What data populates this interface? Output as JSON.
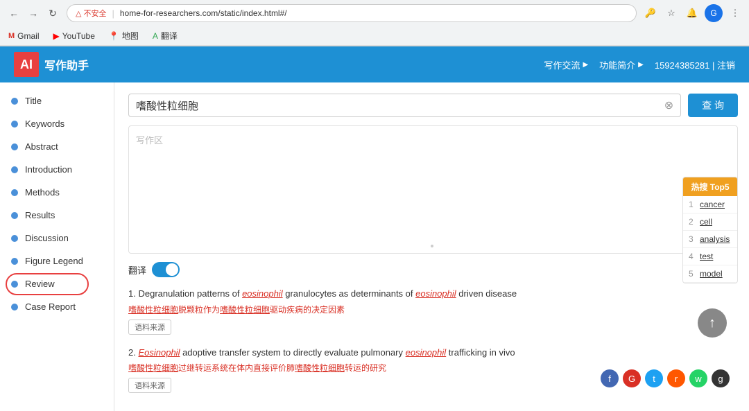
{
  "browser": {
    "security_warning": "不安全",
    "address": "home-for-researchers.com/static/index.html#/",
    "bookmarks": [
      {
        "label": "Gmail",
        "type": "gmail"
      },
      {
        "label": "YouTube",
        "type": "youtube"
      },
      {
        "label": "地图",
        "type": "maps"
      },
      {
        "label": "翻译",
        "type": "translate"
      }
    ]
  },
  "header": {
    "logo_text": "写作助手",
    "logo_icon": "AI",
    "nav_items": [
      "写作交流",
      "功能简介",
      "15924385281 | 注销"
    ]
  },
  "sidebar": {
    "items": [
      {
        "label": "Title",
        "active": false
      },
      {
        "label": "Keywords",
        "active": false
      },
      {
        "label": "Abstract",
        "active": false
      },
      {
        "label": "Introduction",
        "active": false
      },
      {
        "label": "Methods",
        "active": false
      },
      {
        "label": "Results",
        "active": false
      },
      {
        "label": "Discussion",
        "active": false
      },
      {
        "label": "Figure Legend",
        "active": false
      },
      {
        "label": "Review",
        "active": true,
        "highlighted": true
      },
      {
        "label": "Case Report",
        "active": false
      }
    ]
  },
  "search": {
    "query": "嗜酸性粒细胞",
    "placeholder": "写作区",
    "button_label": "查 询",
    "clear_title": "×"
  },
  "translate": {
    "label": "翻译",
    "enabled": true
  },
  "hot_panel": {
    "title": "热搜 Top5",
    "items": [
      {
        "rank": "1",
        "term": "cancer"
      },
      {
        "rank": "2",
        "term": "cell"
      },
      {
        "rank": "3",
        "term": "analysis"
      },
      {
        "rank": "4",
        "term": "test"
      },
      {
        "rank": "5",
        "term": "model"
      }
    ]
  },
  "results": [
    {
      "number": "1.",
      "title_parts": [
        {
          "text": "Degranulation patterns of "
        },
        {
          "text": "eosinophil",
          "highlight": true
        },
        {
          "text": " granulocytes as determinants of "
        },
        {
          "text": "eosinophil",
          "highlight": true
        },
        {
          "text": " driven disease"
        }
      ],
      "title_display": "Degranulation patterns of eosinophil granulocytes as determinants of eosinophil driven disease",
      "translation": "嗜酸性粒细胞脱颗粒作为嗜酸性粒细胞驱动疾病的决定因素",
      "translation_underline1": "嗜酸性粒细胞",
      "translation_underline2": "嗜酸性粒细胞",
      "source_label": "语料来源"
    },
    {
      "number": "2.",
      "title_parts": [
        {
          "text": "Eosinophil",
          "highlight": true
        },
        {
          "text": " adoptive transfer system to directly evaluate pulmonary "
        },
        {
          "text": "eosinophil",
          "highlight": true
        },
        {
          "text": " trafficking in vivo"
        }
      ],
      "title_display": "Eosinophil adoptive transfer system to directly evaluate pulmonary eosinophil trafficking in vivo",
      "translation": "嗜酸性粒细胞过继转运系统在体内直接评价肺嗜酸性粒细胞转运的研究",
      "translation_underline1": "嗜酸性粒细胞",
      "translation_underline2": "嗜酸性粒细胞",
      "source_label": "语料来源"
    }
  ],
  "social_icons": [
    {
      "name": "facebook",
      "symbol": "f",
      "color": "si-blue"
    },
    {
      "name": "google",
      "symbol": "G",
      "color": "si-red"
    },
    {
      "name": "twitter",
      "symbol": "t",
      "color": "si-sky"
    },
    {
      "name": "reddit",
      "symbol": "r",
      "color": "si-orange"
    },
    {
      "name": "whatsapp",
      "symbol": "w",
      "color": "si-green"
    },
    {
      "name": "github",
      "symbol": "g",
      "color": "si-dark"
    }
  ],
  "scroll_up_label": "↑"
}
